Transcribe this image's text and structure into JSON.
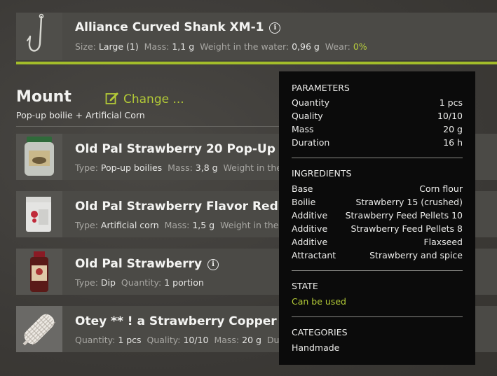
{
  "hook": {
    "title": "Alliance Curved Shank XM-1",
    "meta": [
      {
        "label": "Size:",
        "value": "Large (1)"
      },
      {
        "label": "Mass:",
        "value": "1,1 g"
      },
      {
        "label": "Weight in the water:",
        "value": "0,96 g"
      },
      {
        "label": "Wear:",
        "value": "0%"
      }
    ]
  },
  "mount": {
    "title": "Mount",
    "subtitle": "Pop-up boilie + Artificial Corn",
    "change_label": "Change ..."
  },
  "items": [
    {
      "title": "Old Pal Strawberry 20 Pop-Up",
      "meta": [
        {
          "label": "Type:",
          "value": "Pop-up boilies"
        },
        {
          "label": "Mass:",
          "value": "3,8 g"
        },
        {
          "label": "Weight in the wa",
          "value": ""
        }
      ]
    },
    {
      "title": "Old Pal Strawberry Flavor Red",
      "meta": [
        {
          "label": "Type:",
          "value": "Artificial corn"
        },
        {
          "label": "Mass:",
          "value": "1,5 g"
        },
        {
          "label": "Weight in the wat",
          "value": ""
        }
      ]
    },
    {
      "title": "Old Pal Strawberry",
      "meta": [
        {
          "label": "Type:",
          "value": "Dip"
        },
        {
          "label": "Quantity:",
          "value": "1 portion"
        }
      ]
    },
    {
      "title": "Otey ** ! a Strawberry Copper **",
      "meta": [
        {
          "label": "Quantity:",
          "value": "1 pcs"
        },
        {
          "label": "Quality:",
          "value": "10/10"
        },
        {
          "label": "Mass:",
          "value": "20 g"
        },
        {
          "label": "Duratio",
          "value": ""
        }
      ]
    }
  ],
  "tooltip": {
    "parameters_heading": "PARAMETERS",
    "parameters": [
      {
        "k": "Quantity",
        "v": "1 pcs"
      },
      {
        "k": "Quality",
        "v": "10/10"
      },
      {
        "k": "Mass",
        "v": "20 g"
      },
      {
        "k": "Duration",
        "v": "16 h"
      }
    ],
    "ingredients_heading": "INGREDIENTS",
    "ingredients": [
      {
        "k": "Base",
        "v": "Corn flour"
      },
      {
        "k": "Boilie",
        "v": "Strawberry 15 (crushed)"
      },
      {
        "k": "Additive",
        "v": "Strawberry Feed Pellets 10"
      },
      {
        "k": "Additive",
        "v": "Strawberry Feed Pellets 8"
      },
      {
        "k": "Additive",
        "v": "Flaxseed"
      },
      {
        "k": "Attractant",
        "v": "Strawberry and spice"
      }
    ],
    "state_heading": "STATE",
    "state_value": "Can be used",
    "categories_heading": "CATEGORIES",
    "categories_value": "Handmade"
  },
  "colors": {
    "accent": "#b3ca37",
    "panel": "#4b4a46",
    "tooltip_bg": "#0b0b0b"
  }
}
